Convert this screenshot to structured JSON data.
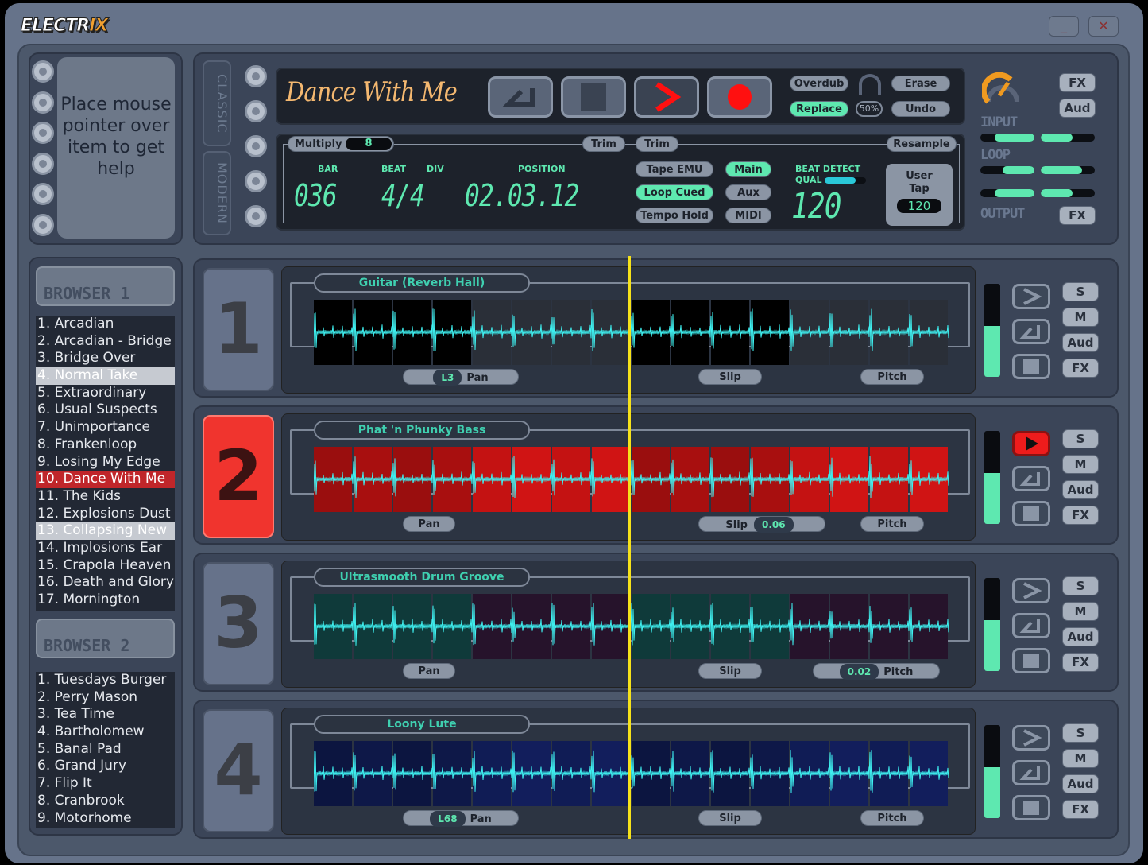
{
  "app": {
    "logo": "ELECTRIX",
    "minimize_icon": "minimize-icon",
    "close_icon": "close-icon"
  },
  "help": {
    "text": "Place mouse pointer over item to get help"
  },
  "view_tabs": [
    "CLASSIC",
    "MODERN"
  ],
  "transport": {
    "song_title": "Dance With Me",
    "buttons": [
      "loop-icon",
      "stop-icon",
      "play-icon",
      "record-icon"
    ],
    "overdub": "Overdub",
    "replace": "Replace",
    "mix_percent": "50%",
    "erase": "Erase",
    "undo": "Undo"
  },
  "display": {
    "multiply_label": "Multiply",
    "multiply_value": "8",
    "trim1": "Trim",
    "trim2": "Trim",
    "resample": "Resample",
    "bar_label": "BAR",
    "beat_label": "BEAT",
    "div_label": "DIV",
    "position_label": "POSITION",
    "bar": "036",
    "beat_div": "4/4",
    "position": "02.03.12",
    "tape_emu": "Tape EMU",
    "loop_cued": "Loop Cued",
    "tempo_hold": "Tempo Hold",
    "main": "Main",
    "aux": "Aux",
    "midi": "MIDI",
    "beat_detect": "BEAT DETECT",
    "qual": "QUAL",
    "qual_level": 0.75,
    "bpm": "120",
    "user_tap": "User Tap",
    "tap_value": "120"
  },
  "levels": {
    "input_label": "INPUT",
    "loop_label": "LOOP",
    "output_label": "OUTPUT",
    "fx_top": "FX",
    "aud": "Aud",
    "fx_bottom": "FX",
    "input_gain": 0.7
  },
  "browser1": {
    "title": "BROWSER 1",
    "items": [
      "1. Arcadian",
      "2. Arcadian - Bridge",
      "3. Bridge Over",
      "4. Normal Take",
      "5. Extraordinary",
      "6. Usual Suspects",
      "7. Unimportance",
      "8. Frankenloop",
      "9. Losing My Edge",
      "10. Dance With Me",
      "11. The Kids",
      "12. Explosions Dust",
      "13. Collapsing New",
      "14. Implosions Ear",
      "15. Crapola Heaven",
      "16. Death and Glory",
      "17. Mornington"
    ],
    "highlighted": [
      3,
      12
    ],
    "active": 9
  },
  "browser2": {
    "title": "BROWSER 2",
    "items": [
      "1. Tuesdays Burger",
      "2. Perry Mason",
      "3. Tea Time",
      "4. Bartholomew",
      "5. Banal Pad",
      "6. Grand Jury",
      "7. Flip It",
      "8. Cranbrook",
      "9. Motorhome"
    ]
  },
  "tracks": [
    {
      "number": "1",
      "name": "Guitar (Reverb Hall)",
      "pan_value": "L3",
      "pan": "Pan",
      "slip": "Slip",
      "slip_value": "",
      "pitch": "Pitch",
      "pitch_value": "",
      "level": 0.55,
      "playing": false,
      "cells": [
        "#000000",
        "#000000",
        "#000000",
        "#000000",
        "#2a2f38",
        "#2a2f38",
        "#2a2f38",
        "#2a2f38",
        "#000000",
        "#000000",
        "#000000",
        "#000000",
        "#2a2f38",
        "#2a2f38",
        "#2a2f38",
        "#2a2f38"
      ],
      "buttons": [
        "S",
        "M",
        "Aud",
        "FX"
      ]
    },
    {
      "number": "2",
      "name": "Phat 'n Phunky Bass",
      "pan_value": "",
      "pan": "Pan",
      "slip": "Slip",
      "slip_value": "0.06",
      "pitch": "Pitch",
      "pitch_value": "",
      "level": 0.55,
      "playing": true,
      "selected": true,
      "cells": [
        "#9a0e0e",
        "#a80f0f",
        "#9a0e0e",
        "#a80f0f",
        "#c41212",
        "#d01414",
        "#c41212",
        "#d01414",
        "#9a0e0e",
        "#a80f0f",
        "#9a0e0e",
        "#a80f0f",
        "#c41212",
        "#d01414",
        "#c41212",
        "#d01414"
      ],
      "buttons": [
        "S",
        "M",
        "Aud",
        "FX"
      ]
    },
    {
      "number": "3",
      "name": "Ultrasmooth Drum Groove",
      "pan_value": "",
      "pan": "Pan",
      "slip": "Slip",
      "slip_value": "",
      "pitch": "Pitch",
      "pitch_value": "0.02",
      "level": 0.55,
      "playing": false,
      "cells": [
        "#0f3a3a",
        "#0f3a3a",
        "#0f3a3a",
        "#0f3a3a",
        "#26132b",
        "#26132b",
        "#26132b",
        "#26132b",
        "#0f3a3a",
        "#0f3a3a",
        "#0f3a3a",
        "#0f3a3a",
        "#26132b",
        "#26132b",
        "#26132b",
        "#26132b"
      ],
      "buttons": [
        "S",
        "M",
        "Aud",
        "FX"
      ]
    },
    {
      "number": "4",
      "name": "Loony Lute",
      "pan_value": "L68",
      "pan": "Pan",
      "slip": "Slip",
      "slip_value": "",
      "pitch": "Pitch",
      "pitch_value": "",
      "level": 0.55,
      "playing": false,
      "cells": [
        "#0c1540",
        "#0e1848",
        "#0c1540",
        "#0e1848",
        "#101c55",
        "#121e5c",
        "#101c55",
        "#121e5c",
        "#0c1540",
        "#0e1848",
        "#0c1540",
        "#0e1848",
        "#101c55",
        "#121e5c",
        "#101c55",
        "#121e5c"
      ],
      "buttons": [
        "S",
        "M",
        "Aud",
        "FX"
      ]
    }
  ],
  "colors": {
    "accent": "#5ee8b0",
    "record": "#ff1010",
    "playhead": "#f6e21a",
    "waveform": "#3ff0f0"
  }
}
